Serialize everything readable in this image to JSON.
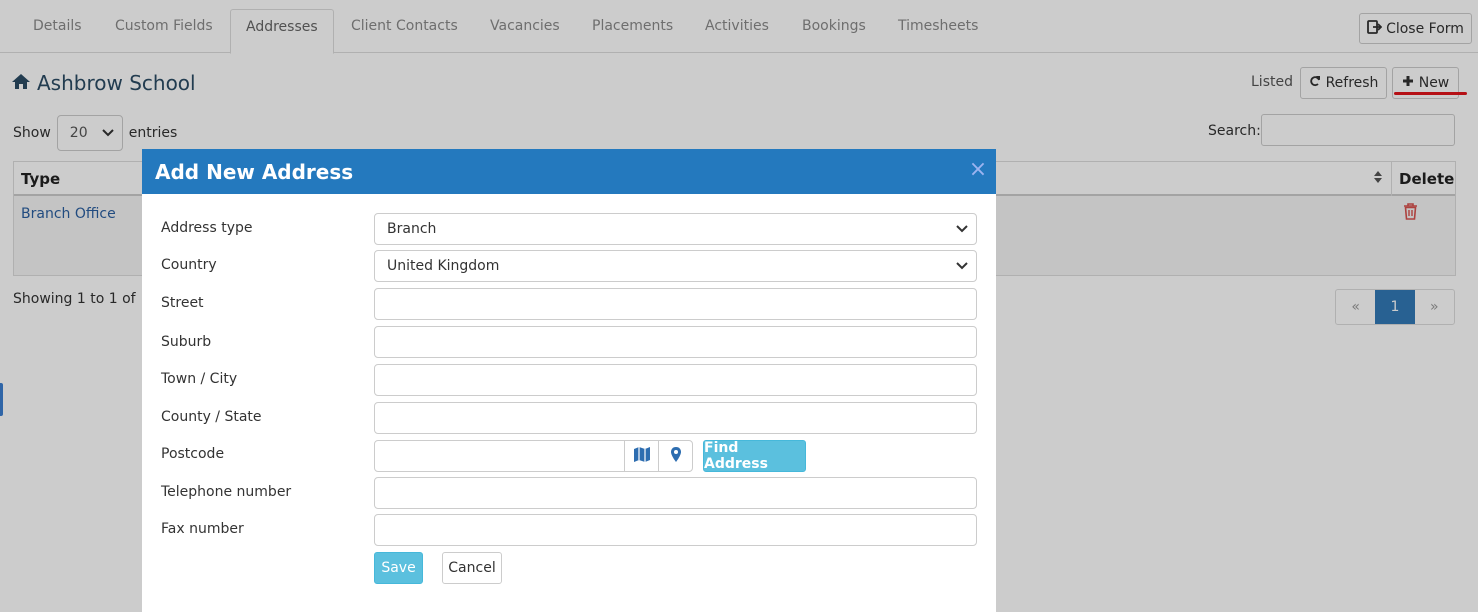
{
  "tabs": [
    "Details",
    "Custom Fields",
    "Addresses",
    "Client Contacts",
    "Vacancies",
    "Placements",
    "Activities",
    "Bookings",
    "Timesheets"
  ],
  "active_tab": "Addresses",
  "close_form_label": "Close Form",
  "page_title": "Ashbrow School",
  "listed_label": "Listed",
  "refresh_label": "Refresh",
  "new_label": "New",
  "show_label": "Show",
  "entries_per_page": "20",
  "entries_label": "entries",
  "search_label": "Search:",
  "search_value": "",
  "table": {
    "columns": [
      "Type",
      "Delete"
    ],
    "rows": [
      {
        "type": "Branch Office"
      }
    ]
  },
  "showing_text": "Showing 1 to 1 of",
  "pagination": {
    "prev": "«",
    "current": "1",
    "next": "»"
  },
  "modal": {
    "title": "Add New Address",
    "close_symbol": "×",
    "fields": {
      "address_type": {
        "label": "Address type",
        "value": "Branch"
      },
      "country": {
        "label": "Country",
        "value": "United Kingdom"
      },
      "street": {
        "label": "Street",
        "value": ""
      },
      "suburb": {
        "label": "Suburb",
        "value": ""
      },
      "town_city": {
        "label": "Town / City",
        "value": ""
      },
      "county_state": {
        "label": "County / State",
        "value": ""
      },
      "postcode": {
        "label": "Postcode",
        "value": ""
      },
      "telephone": {
        "label": "Telephone number",
        "value": ""
      },
      "fax": {
        "label": "Fax number",
        "value": ""
      }
    },
    "find_address_label": "Find Address",
    "save_label": "Save",
    "cancel_label": "Cancel"
  },
  "colors": {
    "modal_header": "#2479be",
    "info_button": "#5bc0de",
    "title_text": "#2b4c64",
    "delete_icon": "#d9534f",
    "new_underline": "#e3141b"
  },
  "icons": {
    "title": "home-icon",
    "close_form": "sign-out-icon",
    "refresh": "refresh-icon",
    "new": "plus-icon",
    "delete": "trash-icon",
    "sort": "sort-icon",
    "map": "map-icon",
    "location": "map-marker-icon"
  }
}
